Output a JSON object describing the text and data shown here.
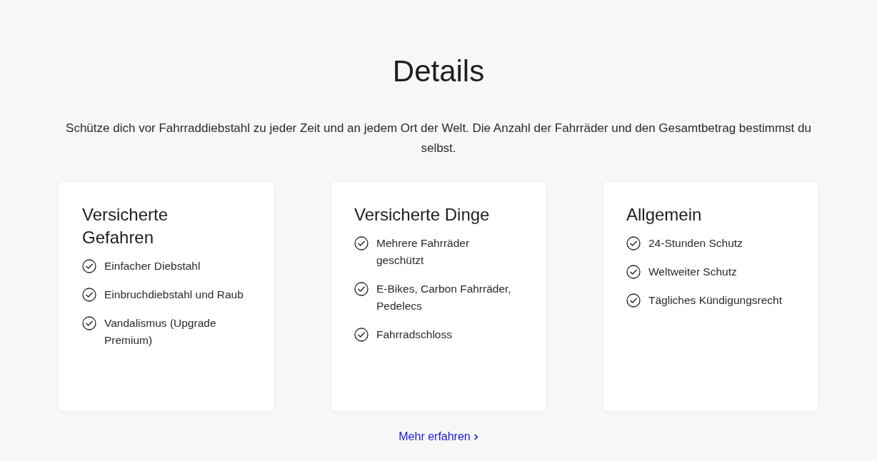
{
  "heading": "Details",
  "intro": "Schütze dich vor Fahrraddiebstahl zu jeder Zeit und an jedem Ort der Welt. Die Anzahl der Fahrräder und den Gesamtbetrag bestimmst du selbst.",
  "cards": [
    {
      "title": "Versicherte Gefahren",
      "items": [
        "Einfacher Diebstahl",
        "Einbruchdiebstahl und Raub",
        "Vandalismus (Upgrade Premium)"
      ]
    },
    {
      "title": "Versicherte Dinge",
      "items": [
        "Mehrere Fahrräder geschützt",
        "E-Bikes, Carbon Fahrräder, Pedelecs",
        "Fahrradschloss"
      ]
    },
    {
      "title": "Allgemein",
      "items": [
        "24-Stunden Schutz",
        "Weltweiter Schutz",
        "Tägliches Kündigungsrecht"
      ]
    }
  ],
  "link": {
    "label": "Mehr erfahren"
  }
}
